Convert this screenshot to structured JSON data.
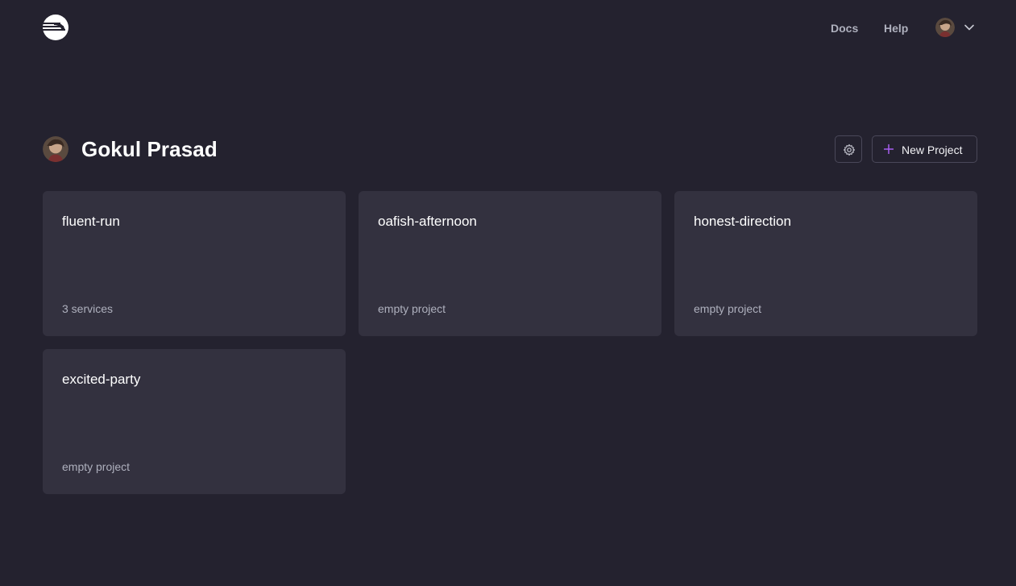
{
  "nav": {
    "docs_label": "Docs",
    "help_label": "Help"
  },
  "user": {
    "name": "Gokul Prasad"
  },
  "toolbar": {
    "new_project_label": "New Project"
  },
  "projects": [
    {
      "name": "fluent-run",
      "meta": "3 services"
    },
    {
      "name": "oafish-afternoon",
      "meta": "empty project"
    },
    {
      "name": "honest-direction",
      "meta": "empty project"
    },
    {
      "name": "excited-party",
      "meta": "empty project"
    }
  ],
  "colors": {
    "background": "#24222f",
    "card": "#33313f",
    "muted_text": "#aeb0bd",
    "accent_purple": "#a75ef0"
  },
  "icons": {
    "logo": "railway-logo-icon",
    "settings": "gear-icon",
    "add": "plus-icon",
    "menu": "chevron-down-icon"
  }
}
